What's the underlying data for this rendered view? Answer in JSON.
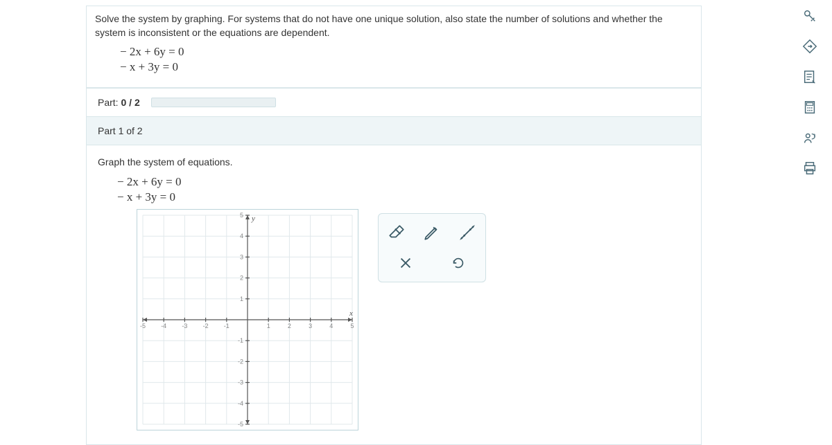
{
  "question": {
    "prompt": "Solve the system by graphing. For systems that do not have one unique solution, also state the number of solutions and whether the system is inconsistent or the equations are dependent.",
    "eq1": "− 2x + 6y = 0",
    "eq2": "− x + 3y = 0"
  },
  "progress": {
    "label_prefix": "Part: ",
    "current": "0",
    "sep": " / ",
    "total": "2",
    "percent": 0
  },
  "part_header": "Part 1 of 2",
  "part_body": {
    "instruction": "Graph the system of equations.",
    "eq1": "− 2x + 6y = 0",
    "eq2": "− x + 3y = 0"
  },
  "chart_data": {
    "type": "scatter",
    "title": "",
    "x": [],
    "y": [],
    "xlabel": "x",
    "ylabel": "y",
    "xlim": [
      -5,
      5
    ],
    "ylim": [
      -5,
      5
    ],
    "xticks": [
      -5,
      -4,
      -3,
      -2,
      -1,
      1,
      2,
      3,
      4,
      5
    ],
    "yticks": [
      -5,
      -4,
      -3,
      -2,
      -1,
      1,
      2,
      3,
      4,
      5
    ],
    "grid": true
  },
  "tools": {
    "eraser": "eraser",
    "pencil": "pencil",
    "line": "line",
    "clear": "clear",
    "undo": "undo"
  },
  "rail": {
    "key": "key",
    "hint": "hint",
    "notes": "notes",
    "calc": "calculator",
    "read": "read-aloud",
    "print": "print"
  }
}
